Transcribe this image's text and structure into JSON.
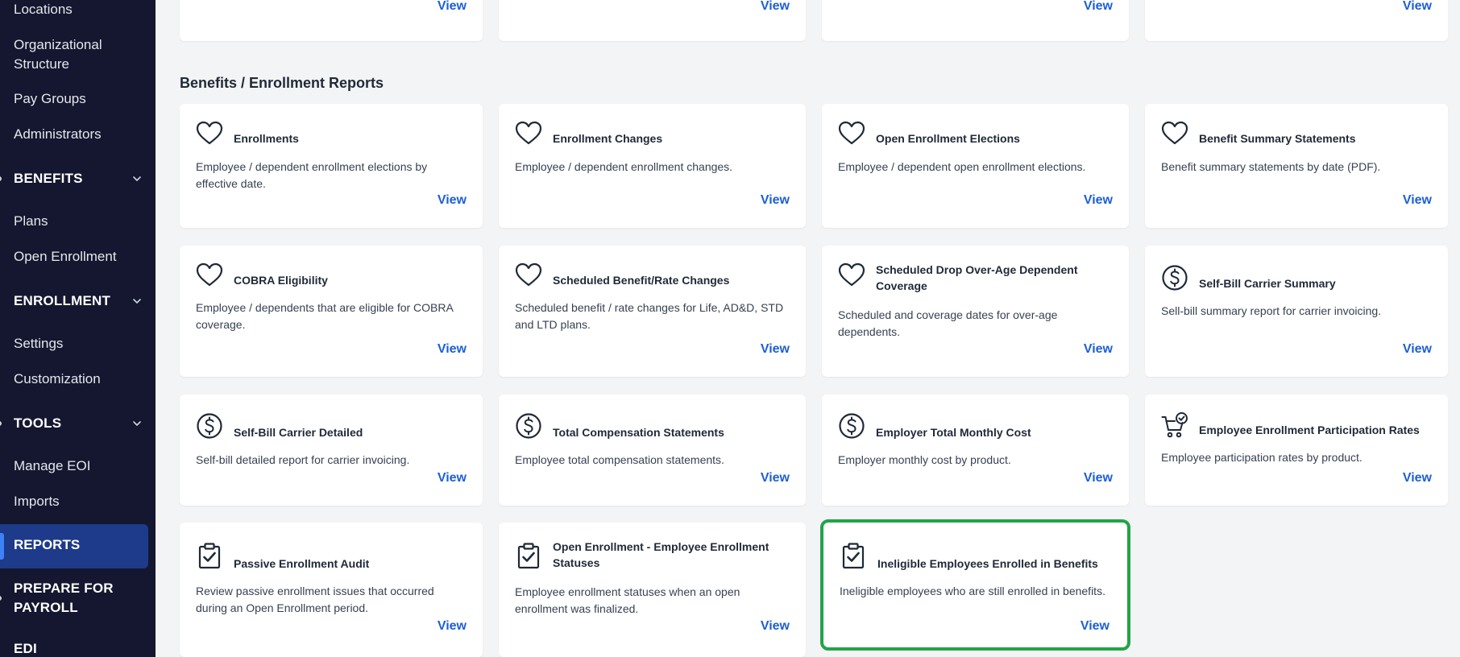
{
  "sidebar": {
    "locations": "Locations",
    "org_structure": "Organizational Structure",
    "pay_groups": "Pay Groups",
    "administrators": "Administrators",
    "benefits": "BENEFITS",
    "plans": "Plans",
    "open_enrollment": "Open Enrollment",
    "enrollment": "ENROLLMENT",
    "settings": "Settings",
    "customization": "Customization",
    "tools": "TOOLS",
    "manage_eoi": "Manage EOI",
    "imports": "Imports",
    "reports": "REPORTS",
    "prepare_payroll": "PREPARE FOR PAYROLL",
    "edi": "EDI"
  },
  "top_row": {
    "view": "View"
  },
  "section": {
    "title": "Benefits / Enrollment Reports"
  },
  "cards": [
    {
      "title": "Enrollments",
      "desc": "Employee / dependent enrollment elections by effective date.",
      "view": "View",
      "icon": "heart-icon"
    },
    {
      "title": "Enrollment Changes",
      "desc": "Employee / dependent enrollment changes.",
      "view": "View",
      "icon": "heart-icon"
    },
    {
      "title": "Open Enrollment Elections",
      "desc": "Employee / dependent open enrollment elections.",
      "view": "View",
      "icon": "heart-icon"
    },
    {
      "title": "Benefit Summary Statements",
      "desc": "Benefit summary statements by date (PDF).",
      "view": "View",
      "icon": "heart-icon"
    },
    {
      "title": "COBRA Eligibility",
      "desc": "Employee / dependents that are eligible for COBRA coverage.",
      "view": "View",
      "icon": "heart-icon"
    },
    {
      "title": "Scheduled Benefit/Rate Changes",
      "desc": "Scheduled benefit / rate changes for Life, AD&D, STD and LTD plans.",
      "view": "View",
      "icon": "heart-icon"
    },
    {
      "title": "Scheduled Drop Over-Age Dependent Coverage",
      "desc": "Scheduled and coverage dates for over-age dependents.",
      "view": "View",
      "icon": "heart-icon"
    },
    {
      "title": "Self-Bill Carrier Summary",
      "desc": "Sell-bill summary report for carrier invoicing.",
      "view": "View",
      "icon": "dollar-icon"
    },
    {
      "title": "Self-Bill Carrier Detailed",
      "desc": "Self-bill detailed report for carrier invoicing.",
      "view": "View",
      "icon": "dollar-icon"
    },
    {
      "title": "Total Compensation Statements",
      "desc": "Employee total compensation statements.",
      "view": "View",
      "icon": "dollar-icon"
    },
    {
      "title": "Employer Total Monthly Cost",
      "desc": "Employer monthly cost by product.",
      "view": "View",
      "icon": "dollar-icon"
    },
    {
      "title": "Employee Enrollment Participation Rates",
      "desc": "Employee participation rates by product.",
      "view": "View",
      "icon": "cart-check-icon"
    },
    {
      "title": "Passive Enrollment Audit",
      "desc": "Review passive enrollment issues that occurred during an Open Enrollment period.",
      "view": "View",
      "icon": "clipboard-check-icon"
    },
    {
      "title": "Open Enrollment - Employee Enrollment Statuses",
      "desc": "Employee enrollment statuses when an open enrollment was finalized.",
      "view": "View",
      "icon": "clipboard-check-icon"
    },
    {
      "title": "Ineligible Employees Enrolled in Benefits",
      "desc": "Ineligible employees who are still enrolled in benefits.",
      "view": "View",
      "icon": "clipboard-check-icon"
    }
  ],
  "colors": {
    "sidebar_bg": "#14172f",
    "active_bg": "#1e3a8a",
    "link": "#1d5fd6",
    "highlight": "#22a447"
  }
}
